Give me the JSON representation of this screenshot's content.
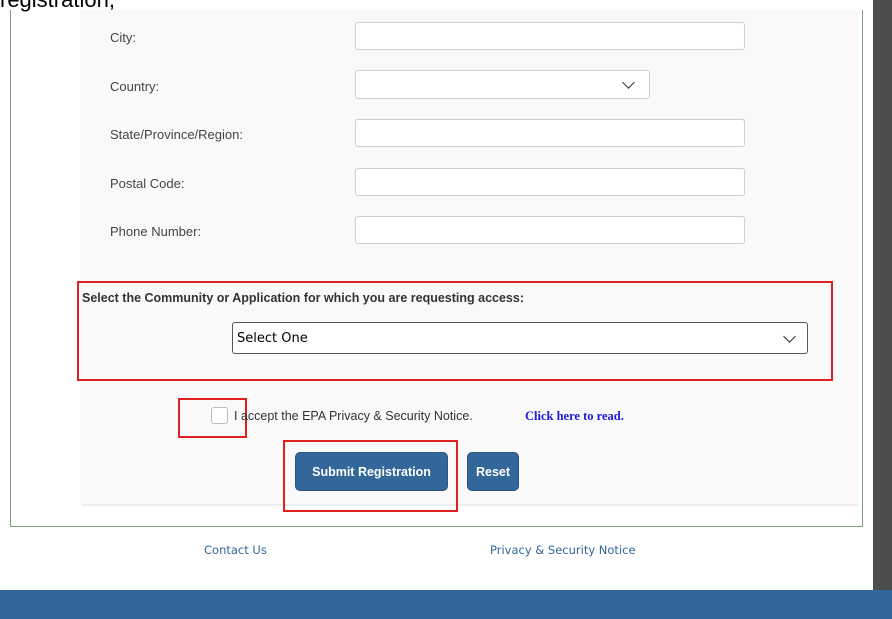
{
  "page": {
    "top_caption": "registration,"
  },
  "form": {
    "fields": [
      {
        "label": "City:",
        "value": ""
      },
      {
        "label": "Country:",
        "value": ""
      },
      {
        "label": "State/Province/Region:",
        "value": ""
      },
      {
        "label": "Postal Code:",
        "value": ""
      },
      {
        "label": "Phone Number:",
        "value": ""
      }
    ],
    "community": {
      "label": "Select the Community or Application for which you are requesting access:",
      "selected": "Select One"
    },
    "accept": {
      "text": "I accept the EPA Privacy & Security Notice.",
      "link": "Click here to read."
    },
    "buttons": {
      "submit": "Submit Registration",
      "reset": "Reset"
    }
  },
  "footer": {
    "contact": "Contact Us",
    "privacy": "Privacy & Security Notice"
  },
  "colors": {
    "button_bg": "#336699",
    "highlight_box": "#e02020",
    "link": "#1a1adb",
    "bottom_bar": "#336699"
  }
}
